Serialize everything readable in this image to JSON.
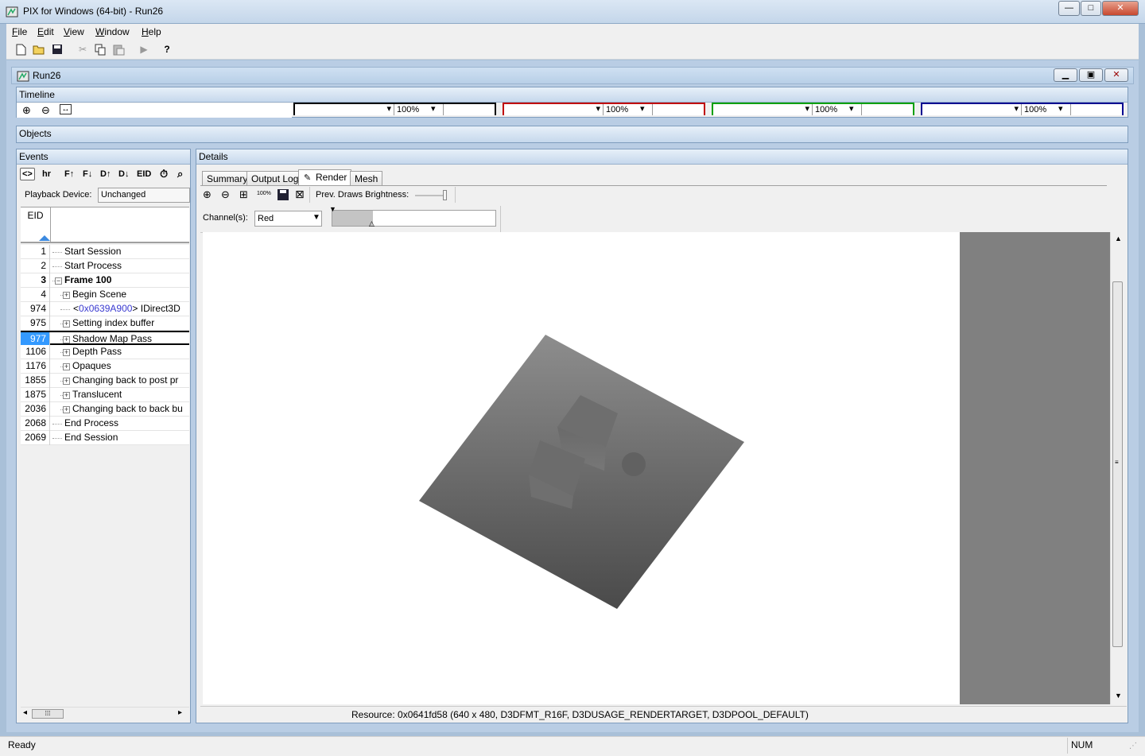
{
  "window": {
    "title": "PIX for Windows (64-bit) - Run26",
    "minimize": "—",
    "maximize": "□",
    "close": "✕"
  },
  "menu": [
    {
      "label": "File",
      "accel": "F",
      "rest": "ile"
    },
    {
      "label": "Edit",
      "accel": "E",
      "rest": "dit"
    },
    {
      "label": "View",
      "accel": "V",
      "rest": "iew"
    },
    {
      "label": "Window",
      "accel": "W",
      "rest": "indow"
    },
    {
      "label": "Help",
      "accel": "H",
      "rest": "elp"
    }
  ],
  "child": {
    "title": "Run26"
  },
  "timeline": {
    "title": "Timeline",
    "tracks": [
      {
        "zoom": "100%",
        "color": "#000000"
      },
      {
        "zoom": "100%",
        "color": "#c00000"
      },
      {
        "zoom": "100%",
        "color": "#00a000"
      },
      {
        "zoom": "100%",
        "color": "#000090"
      }
    ]
  },
  "objects": {
    "title": "Objects"
  },
  "events": {
    "title": "Events",
    "toolbar": [
      "<>",
      "hr",
      "F↑",
      "F↓",
      "D↑",
      "D↓",
      "EID"
    ],
    "playback_label": "Playback Device:",
    "playback_value": "Unchanged",
    "column_eid": "EID",
    "rows": [
      {
        "eid": "1",
        "name": "Start Session",
        "indent": 0,
        "expander": false,
        "bold": false
      },
      {
        "eid": "2",
        "name": "Start Process",
        "indent": 0,
        "expander": false,
        "bold": false
      },
      {
        "eid": "3",
        "name": "Frame 100",
        "indent": 0,
        "expander": "minus",
        "bold": true
      },
      {
        "eid": "4",
        "name": "Begin Scene",
        "indent": 1,
        "expander": "plus",
        "bold": false
      },
      {
        "eid": "974",
        "name_prefix": "<",
        "name_link": "0x0639A900",
        "name_suffix": "> IDirect3D",
        "indent": 1,
        "expander": false,
        "bold": false
      },
      {
        "eid": "975",
        "name": "Setting index buffer",
        "indent": 1,
        "expander": "plus",
        "bold": false
      },
      {
        "eid": "977",
        "name": "Shadow Map Pass",
        "indent": 1,
        "expander": "plus",
        "bold": false,
        "selected": true
      },
      {
        "eid": "1106",
        "name": "Depth Pass",
        "indent": 1,
        "expander": "plus",
        "bold": false
      },
      {
        "eid": "1176",
        "name": "Opaques",
        "indent": 1,
        "expander": "plus",
        "bold": false
      },
      {
        "eid": "1855",
        "name": "Changing back to post pr",
        "indent": 1,
        "expander": "plus",
        "bold": false
      },
      {
        "eid": "1875",
        "name": "Translucent",
        "indent": 1,
        "expander": "plus",
        "bold": false
      },
      {
        "eid": "2036",
        "name": "Changing back to back bu",
        "indent": 1,
        "expander": "plus",
        "bold": false
      },
      {
        "eid": "2068",
        "name": "End Process",
        "indent": 0,
        "expander": false,
        "bold": false
      },
      {
        "eid": "2069",
        "name": "End Session",
        "indent": 0,
        "expander": false,
        "bold": false
      }
    ]
  },
  "details": {
    "title": "Details",
    "tabs": [
      "Summary",
      "Output Log",
      "Render",
      "Mesh"
    ],
    "active_tab": "Render",
    "brightness_label": "Prev. Draws Brightness:",
    "zoom_100_label": "100%",
    "channel_label": "Channel(s):",
    "channel_value": "Red",
    "resource_text": "Resource: 0x0641fd58 (640 x 480, D3DFMT_R16F, D3DUSAGE_RENDERTARGET, D3DPOOL_DEFAULT)"
  },
  "status": {
    "text": "Ready",
    "num": "NUM"
  }
}
